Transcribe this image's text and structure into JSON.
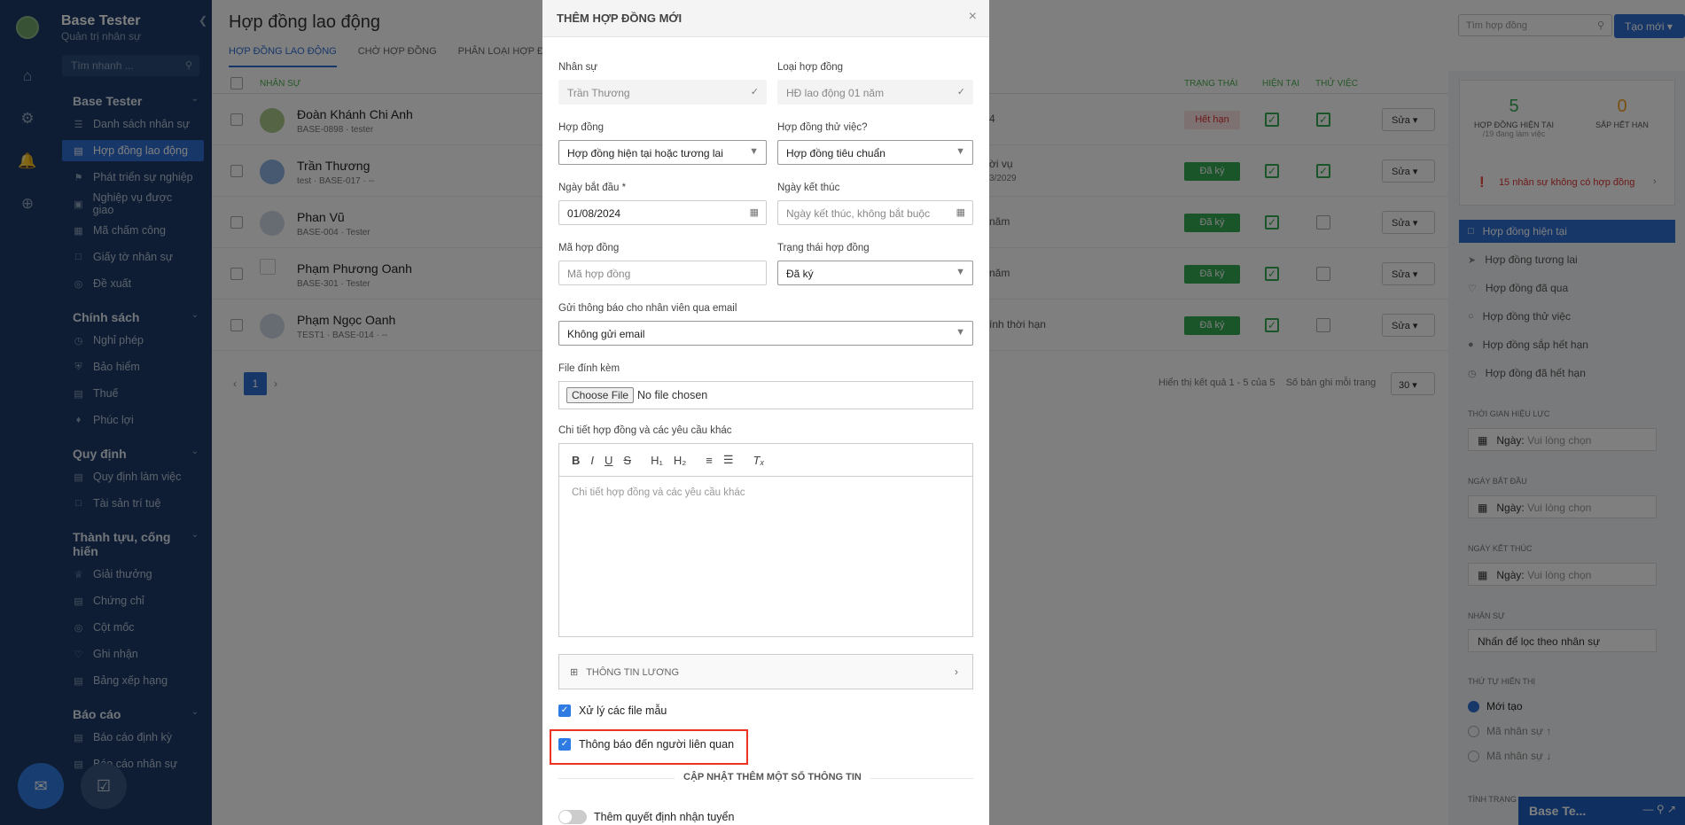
{
  "sidebar": {
    "user_name": "Base Tester",
    "user_role": "Quản trị nhân sự",
    "search_placeholder": "Tìm nhanh ...",
    "sections": [
      {
        "title": "Base Tester",
        "items": [
          "Danh sách nhân sự",
          "Hợp đồng lao động",
          "Phát triển sự nghiệp",
          "Nghiệp vụ được giao",
          "Mã chấm công",
          "Giấy tờ nhân sự",
          "Đề xuất"
        ]
      },
      {
        "title": "Chính sách",
        "items": [
          "Nghỉ phép",
          "Bảo hiểm",
          "Thuế",
          "Phúc lợi"
        ]
      },
      {
        "title": "Quy định",
        "items": [
          "Quy định làm việc",
          "Tài sản trí tuệ"
        ]
      },
      {
        "title": "Thành tựu, cống hiến",
        "items": [
          "Giải thưởng",
          "Chứng chỉ",
          "Cột mốc",
          "Ghi nhận",
          "Bảng xếp hạng"
        ]
      },
      {
        "title": "Báo cáo",
        "items": [
          "Báo cáo định kỳ",
          "Báo cáo nhân sự"
        ]
      }
    ]
  },
  "main": {
    "title": "Hợp đồng lao động",
    "tabs": [
      "HỢP ĐỒNG LAO ĐỘNG",
      "CHỜ HỢP ĐỒNG",
      "PHÂN LOẠI HỢP Đ"
    ],
    "search_placeholder": "Tìm hợp đồng",
    "new_button": "Tạo mới",
    "headers": {
      "employee": "NHÂN SỰ",
      "status": "TRẠNG THÁI",
      "current": "HIỆN TẠI",
      "probation": "THỬ VIỆC"
    },
    "rows": [
      {
        "name": "Đoàn Khánh Chi Anh",
        "sub": "BASE-0898 · tester",
        "extra": "4",
        "status": "Hết hạn",
        "current": true,
        "probation": true
      },
      {
        "name": "Trần Thương",
        "sub": "test · BASE-017 · --",
        "extra": "ời vụ",
        "extra2": "3/2029",
        "status": "Đã ký",
        "current": true,
        "probation": true
      },
      {
        "name": "Phan Vũ",
        "sub": "BASE-004 · Tester",
        "extra": "năm",
        "status": "Đã ký",
        "current": true,
        "probation": false
      },
      {
        "name": "Phạm Phương Oanh",
        "sub": "BASE-301 · Tester",
        "extra": "năm",
        "status": "Đã ký",
        "current": true,
        "probation": false
      },
      {
        "name": "Phạm Ngọc Oanh",
        "sub": "TEST1 · BASE-014 · --",
        "extra": "ính thời hạn",
        "status": "Đã ký",
        "current": true,
        "probation": false
      }
    ],
    "edit_label": "Sửa",
    "page": "1",
    "result_text": "Hiển thị kết quả 1 - 5 của 5",
    "per_page_label": "Số bản ghi mỗi trang",
    "per_page": "30"
  },
  "right_panel": {
    "current_count": "5",
    "current_label": "HỢP ĐỒNG HIỆN TẠI",
    "current_sub": "/19 đang làm việc",
    "expiring_count": "0",
    "expiring_label": "SẮP HẾT HẠN",
    "warning": "15 nhân sự không có hợp đồng",
    "filters": [
      "Hợp đồng hiện tại",
      "Hợp đồng tương lai",
      "Hợp đồng đã qua",
      "Hợp đồng thử việc",
      "Hợp đồng sắp hết hạn",
      "Hợp đồng đã hết hạn"
    ],
    "validity_label": "THỜI GIAN HIỆU LỰC",
    "start_label": "NGÀY BẮT ĐẦU",
    "end_label": "NGÀY KẾT THÚC",
    "date_prefix": "Ngày:",
    "date_placeholder": "Vui lòng chọn",
    "employee_label": "NHÂN SỰ",
    "employee_placeholder": "Nhấn để lọc theo nhân sự",
    "order_label": "THỨ TỰ HIỂN THỊ",
    "order_options": [
      "Mới tạo",
      "Mã nhân sự ↑",
      "Mã nhân sự ↓"
    ],
    "status_label": "TÌNH TRẠNG",
    "mini_chat": "Base Te..."
  },
  "modal": {
    "title": "THÊM HỢP ĐỒNG MỚI",
    "employee_label": "Nhân sự",
    "employee_value": "Trần Thương",
    "type_label": "Loại hợp đồng",
    "type_value": "HĐ lao động 01 năm",
    "contract_label": "Hợp đồng",
    "contract_value": "Hợp đồng hiện tại hoặc tương lai",
    "probation_label": "Hợp đồng thử việc?",
    "probation_value": "Hợp đồng tiêu chuẩn",
    "start_label": "Ngày bắt đầu *",
    "start_value": "01/08/2024",
    "end_label": "Ngày kết thúc",
    "end_placeholder": "Ngày kết thúc, không bắt buộc",
    "code_label": "Mã hợp đồng",
    "code_placeholder": "Mã hợp đồng",
    "status_label": "Trạng thái hợp đồng",
    "status_value": "Đã ký",
    "email_label": "Gửi thông báo cho nhân viên qua email",
    "email_value": "Không gửi email",
    "file_label": "File đính kèm",
    "file_button": "Choose File",
    "file_status": "No file chosen",
    "detail_label": "Chi tiết hợp đồng và các yêu cầu khác",
    "detail_placeholder": "Chi tiết hợp đồng và các yêu cầu khác",
    "salary_label": "THÔNG TIN LƯƠNG",
    "check_template": "Xử lý các file mẫu",
    "check_notify": "Thông báo đến người liên quan",
    "update_section": "CẬP NHẬT THÊM MỘT SỐ THÔNG TIN",
    "toggle_label": "Thêm quyết định nhận tuyển"
  }
}
